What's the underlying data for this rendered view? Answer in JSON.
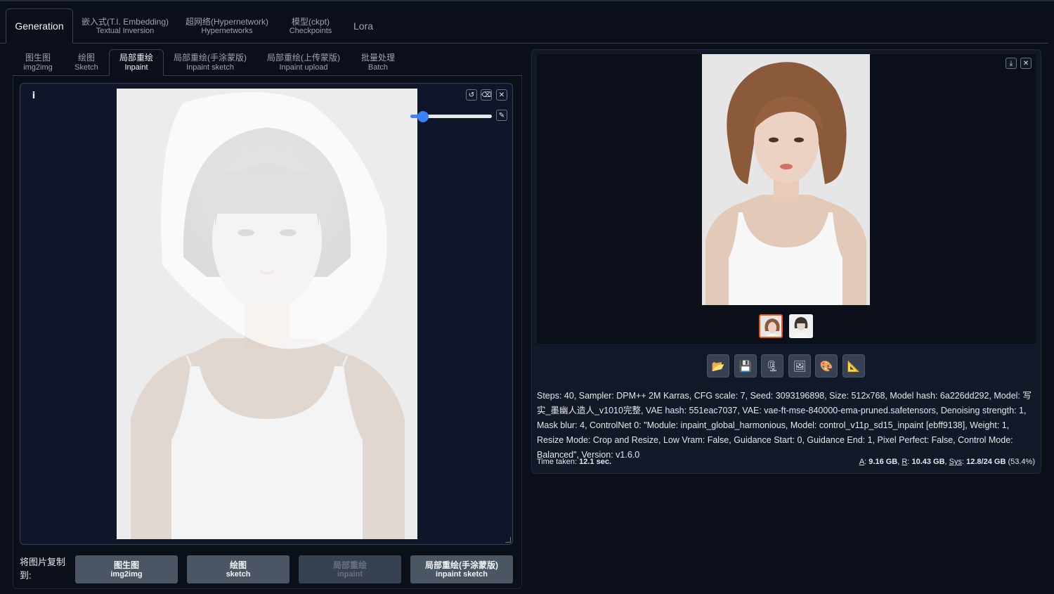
{
  "main_tabs": [
    {
      "label": "Generation"
    },
    {
      "line1": "嵌入式(T.I. Embedding)",
      "line2": "Textual Inversion"
    },
    {
      "line1": "超网络(Hypernetwork)",
      "line2": "Hypernetworks"
    },
    {
      "line1": "模型(ckpt)",
      "line2": "Checkpoints"
    },
    {
      "label": "Lora"
    }
  ],
  "sub_tabs": [
    {
      "line1": "图生图",
      "line2": "img2img"
    },
    {
      "line1": "绘图",
      "line2": "Sketch"
    },
    {
      "line1": "局部重绘",
      "line2": "Inpaint"
    },
    {
      "line1": "局部重绘(手涂蒙版)",
      "line2": "Inpaint sketch"
    },
    {
      "line1": "局部重绘(上传蒙版)",
      "line2": "Inpaint upload"
    },
    {
      "line1": "批量处理",
      "line2": "Batch"
    }
  ],
  "editor": {
    "info_icon": "i",
    "undo_icon": "↺",
    "eraser_icon": "⌫",
    "close_icon": "✕",
    "brush_icon": "✎",
    "brush_size_fraction": 0.1
  },
  "copy_to": {
    "label": "将图片复制到:",
    "buttons": [
      {
        "line1": "图生图",
        "line2": "img2img",
        "enabled": true
      },
      {
        "line1": "绘图",
        "line2": "sketch",
        "enabled": true
      },
      {
        "line1": "局部重绘",
        "line2": "inpaint",
        "enabled": false
      },
      {
        "line1": "局部重绘(手涂蒙版)",
        "line2": "inpaint sketch",
        "enabled": true
      }
    ]
  },
  "gallery": {
    "download_icon": "⤓",
    "close_icon": "✕",
    "selected_thumb": 0
  },
  "actions": [
    {
      "icon": "folder-icon",
      "glyph": "📂"
    },
    {
      "icon": "save-icon",
      "glyph": "💾"
    },
    {
      "icon": "zip-icon",
      "glyph": "🗜"
    },
    {
      "icon": "image-icon",
      "glyph": "🖼"
    },
    {
      "icon": "palette-icon",
      "glyph": "🎨"
    },
    {
      "icon": "ruler-icon",
      "glyph": "📐"
    }
  ],
  "generation_info": "Steps: 40, Sampler: DPM++ 2M Karras, CFG scale: 7, Seed: 3093196898, Size: 512x768, Model hash: 6a226dd292, Model: 写实_墨幽人造人_v1010完整, VAE hash: 551eac7037, VAE: vae-ft-mse-840000-ema-pruned.safetensors, Denoising strength: 1, Mask blur: 4, ControlNet 0: \"Module: inpaint_global_harmonious, Model: control_v11p_sd15_inpaint [ebff9138], Weight: 1, Resize Mode: Crop and Resize, Low Vram: False, Guidance Start: 0, Guidance End: 1, Pixel Perfect: False, Control Mode: Balanced\", Version: v1.6.0",
  "time_taken": {
    "label": "Time taken:",
    "value": "12.1 sec."
  },
  "vram": {
    "a_label": "A",
    "a_value": "9.16 GB",
    "r_label": "R",
    "r_value": "10.43 GB",
    "sys_label": "Sys",
    "sys_value": "12.8/24 GB",
    "sys_pct": "(53.4%)"
  },
  "colors": {
    "background": "#0b0f19",
    "accent_blue": "#3b82f6",
    "selected_thumb_border": "#ea580c"
  }
}
